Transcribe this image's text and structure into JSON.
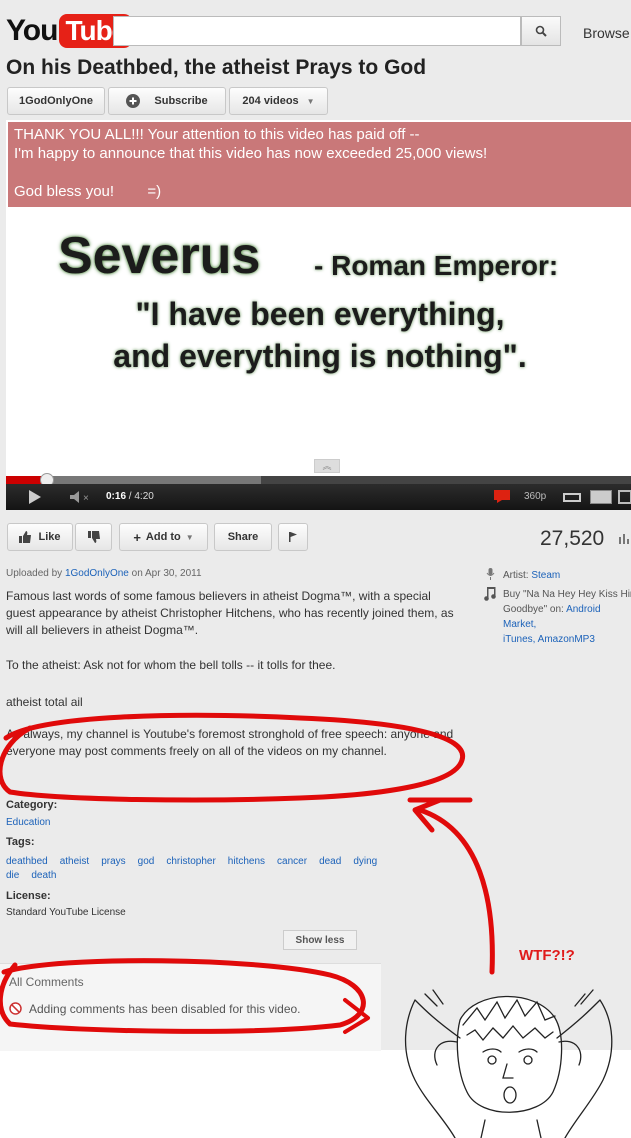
{
  "header": {
    "logo_you": "You",
    "logo_tube": "Tube",
    "search_placeholder": "",
    "browse_label": "Browse"
  },
  "video": {
    "title": "On his Deathbed, the atheist Prays to God",
    "channel_label": "1GodOnlyOne",
    "subscribe_label": "Subscribe",
    "videos_label": "204 videos",
    "banner_text": "THANK YOU ALL!!! Your attention to this video has paid off --\nI'm happy to announce that this video has now exceeded 25,000 views!\n\nGod bless you!        =)",
    "quote_name": "Severus",
    "quote_role": "- Roman Emperor:",
    "quote_line1": "\"I have been everything,",
    "quote_line2": "and everything is nothing\".",
    "time_current": "0:16",
    "time_total": "/ 4:20",
    "quality_label": "360p",
    "progress_fraction": 0.064
  },
  "actions": {
    "like_label": "Like",
    "addto_label": "Add to",
    "share_label": "Share",
    "view_count": "27,520"
  },
  "description": {
    "uploaded_prefix": "Uploaded by",
    "uploader": "1GodOnlyOne",
    "upload_date": "on Apr 30, 2011",
    "para1": "Famous last words of some famous believers in atheist Dogma™, with a special guest appearance by atheist Christopher Hitchens, who has recently joined them, as will all believers in atheist Dogma™.",
    "para2": "To the atheist: Ask not for whom the bell tolls -- it tolls for thee.",
    "para3": "atheist total ail",
    "para4": "As always, my channel is Youtube's foremost stronghold of free speech: anyone and everyone may post comments freely on all of the videos on my channel.",
    "category_head": "Category:",
    "category_value": "Education",
    "tags_head": "Tags:",
    "tags": [
      "deathbed",
      "atheist",
      "prays",
      "god",
      "christopher",
      "hitchens",
      "cancer",
      "dead",
      "dying",
      "die",
      "death"
    ],
    "license_head": "License:",
    "license_value": "Standard YouTube License",
    "show_less": "Show less"
  },
  "sidebar": {
    "artist_prefix": "Artist:",
    "artist": "Steam",
    "buy_text": "Buy \"Na Na Hey Hey Kiss Him Goodbye\" on:",
    "store1": "Android",
    "store2": "Market,",
    "store3": "iTunes,",
    "store4": "AmazonMP3"
  },
  "comments": {
    "header": "All Comments",
    "disabled_message": "Adding comments has been disabled for this video."
  },
  "annotation": {
    "wtf_text": "WTF?!?"
  },
  "colors": {
    "banner_bg": "#c97879",
    "link": "#1c62b9",
    "annotation_red": "#e00a0a",
    "logo_red": "#e62117"
  }
}
